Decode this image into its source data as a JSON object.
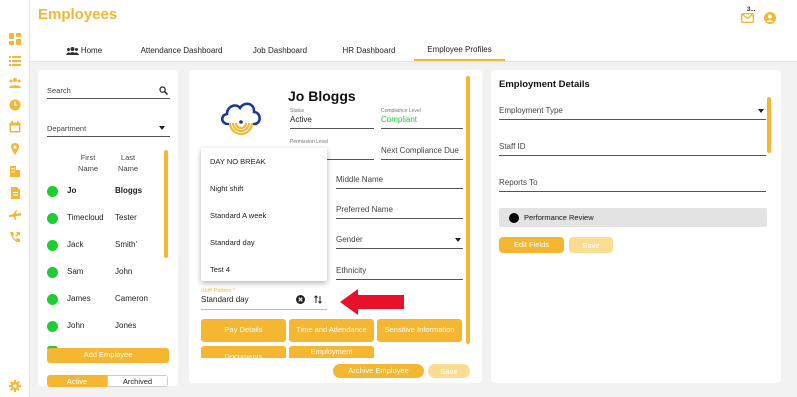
{
  "app": {
    "title": "Employees",
    "notification_badge": "3..."
  },
  "nav": {
    "tabs": [
      {
        "label": "Home"
      },
      {
        "label": "Attendance Dashboard"
      },
      {
        "label": "Job Dashboard"
      },
      {
        "label": "HR Dashboard"
      },
      {
        "label": "Employee Profiles"
      }
    ]
  },
  "list_panel": {
    "search_placeholder": "Search",
    "department_label": "Department",
    "col_first": "First Name",
    "col_last": "Last Name",
    "rows": [
      {
        "first": "Jo",
        "last": "Bloggs",
        "bold": true
      },
      {
        "first": "Timecloud",
        "last": "Tester",
        "bold": false
      },
      {
        "first": "Jack",
        "last": "Smith'",
        "bold": false
      },
      {
        "first": "Sam",
        "last": "John",
        "bold": false
      },
      {
        "first": "James",
        "last": "Cameron",
        "bold": false
      },
      {
        "first": "John",
        "last": "Jones",
        "bold": false
      }
    ],
    "add_button": "Add Employee",
    "toggle_active": "Active",
    "toggle_archived": "Archived"
  },
  "profile": {
    "name": "Jo Bloggs",
    "status_label": "Status",
    "status_value": "Active",
    "compliance_label": "Compliance Level",
    "compliance_value": "Compliant",
    "permission_label": "Permission Level",
    "next_compliance": "Next Compliance Due",
    "middle_name": "Middle Name",
    "preferred_name": "Preferred Name",
    "gender": "Gender",
    "ethnicity": "Ethnicity",
    "shift_label": "Shift Pattern *",
    "shift_value": "Standard day",
    "shift_options": [
      "DAY NO BREAK",
      "Night shift",
      "Standard A week",
      "Standard day",
      "Test 4"
    ],
    "buttons": {
      "pay": "Pay Details",
      "time_attendance": "Time and Attendance",
      "sensitive": "Sensitive Information",
      "documents": "Documents",
      "employment": "Employment",
      "archive": "Archive Employee",
      "save": "Save"
    }
  },
  "employment": {
    "title": "Employment Details",
    "type": "Employment Type",
    "staff_id": "Staff ID",
    "reports_to": "Reports To",
    "performance": "Performance Review",
    "edit": "Edit Fields",
    "save": "Save"
  },
  "colors": {
    "accent": "#f5b731",
    "green": "#1fcc33",
    "arrow": "#e8102a"
  }
}
